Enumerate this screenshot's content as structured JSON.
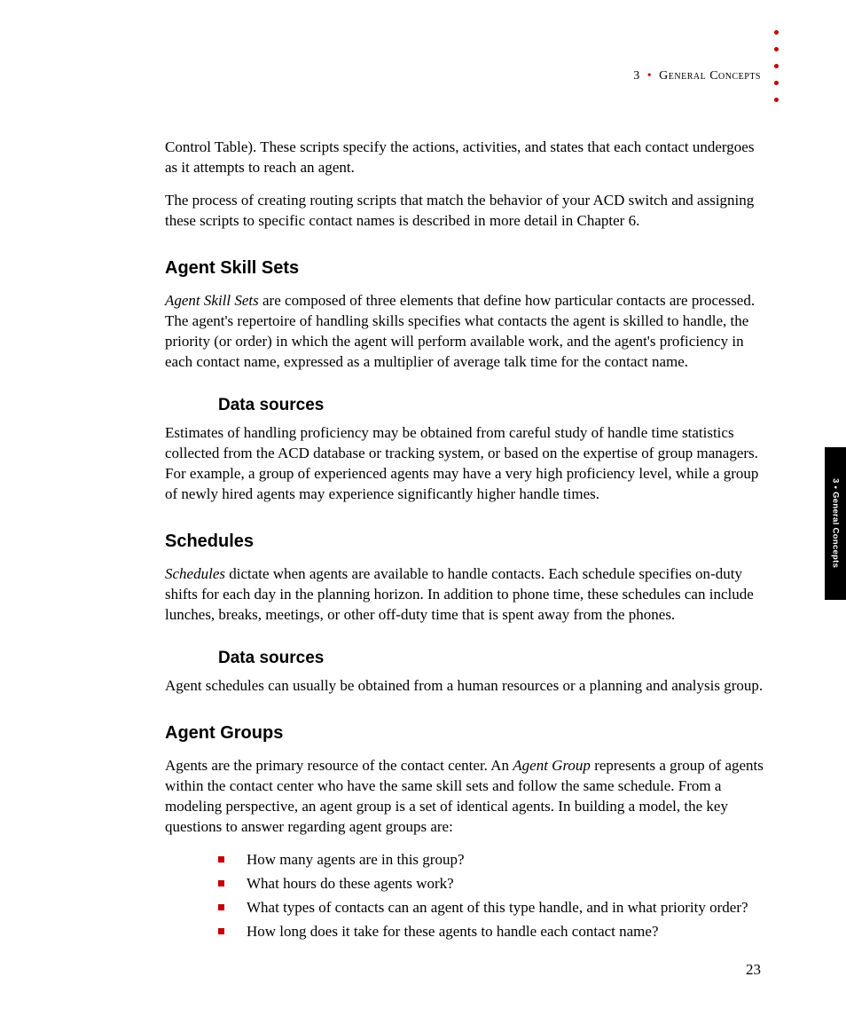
{
  "header": {
    "chapter_number": "3",
    "separator": "•",
    "chapter_title": "General Concepts"
  },
  "body": {
    "intro": {
      "p1": "Control Table). These scripts specify the actions, activities, and states that each contact undergoes as it attempts to reach an agent.",
      "p2": "The process of creating routing scripts that match the behavior of your ACD switch and assigning these scripts to specific contact names is described in more detail in Chapter 6."
    },
    "agent_skill_sets": {
      "heading": "Agent Skill Sets",
      "lead_italic": "Agent Skill Sets",
      "p1_rest": " are composed of three elements that define how particular contacts are processed. The agent's repertoire of handling skills specifies what contacts the agent is skilled to handle, the priority (or order) in which the agent will perform available work, and the agent's proficiency in each contact name, expressed as a multiplier of average talk time for the contact name.",
      "sub1_heading": "Data sources",
      "sub1_p1": "Estimates of handling proficiency may be obtained from careful study of handle time statistics collected from the ACD database or tracking system, or based on the expertise of group managers. For example, a group of experienced agents may have a very high proficiency level, while a group of newly hired agents may experience significantly higher handle times."
    },
    "schedules": {
      "heading": "Schedules",
      "lead_italic": "Schedules",
      "p1_rest": " dictate when agents are available to handle contacts. Each schedule specifies on-duty shifts for each day in the planning horizon. In addition to phone time, these schedules can include lunches, breaks, meetings, or other off-duty time that is spent away from the phones.",
      "sub1_heading": "Data sources",
      "sub1_p1": "Agent schedules can usually be obtained from a human resources or a planning and analysis group."
    },
    "agent_groups": {
      "heading": "Agent Groups",
      "p1_pre": "Agents are the primary resource of the contact center. An ",
      "p1_italic": "Agent Group",
      "p1_post": " represents a group of agents within the contact center who have the same skill sets and follow the same schedule. From a modeling perspective, an agent group is a set of identical agents. In building a model, the key questions to answer regarding agent groups are:",
      "bullets": [
        "How many agents are in this group?",
        "What hours do these agents work?",
        "What types of contacts can an agent of this type handle, and in what priority order?",
        "How long does it take for these agents to handle each contact name?"
      ]
    }
  },
  "side_tab": "3 • General Concepts",
  "page_number": "23"
}
